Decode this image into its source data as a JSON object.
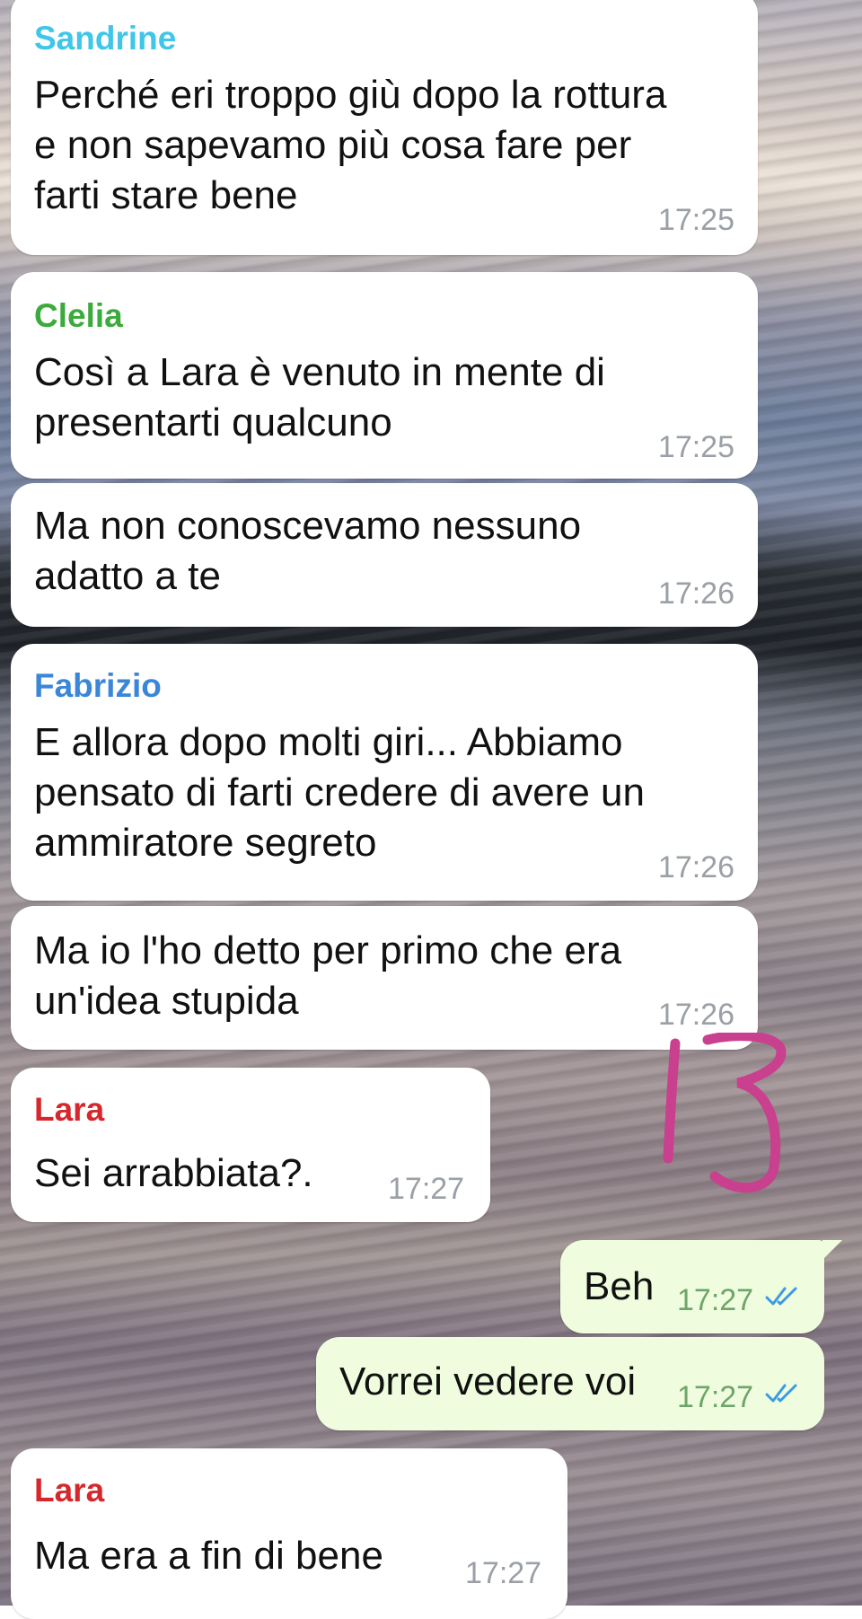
{
  "messages": [
    {
      "sender": "Sandrine",
      "text": "Perché eri troppo giù dopo la rottura\ne non sapevamo più cosa fare per\nfarti stare bene",
      "time": "17:25"
    },
    {
      "sender": "Clelia",
      "text": "Così a Lara è venuto in mente di\npresentarti qualcuno",
      "time": "17:25"
    },
    {
      "sender": "",
      "text": "Ma non conoscevamo nessuno\nadatto a te",
      "time": "17:26"
    },
    {
      "sender": "Fabrizio",
      "text": "E allora dopo molti giri... Abbiamo\npensato di farti credere di avere un\nammiratore segreto",
      "time": "17:26"
    },
    {
      "sender": "",
      "text": "Ma io l'ho detto per primo che era\nun'idea stupida",
      "time": "17:26"
    },
    {
      "sender": "Lara",
      "text": "Sei arrabbiata?.",
      "time": "17:27"
    },
    {
      "sender": "",
      "text": "Beh",
      "time": "17:27",
      "outgoing": true,
      "status": "read"
    },
    {
      "sender": "",
      "text": "Vorrei vedere voi",
      "time": "17:27",
      "outgoing": true,
      "status": "read"
    },
    {
      "sender": "Lara",
      "text": "Ma era a fin di bene",
      "time": "17:27"
    }
  ],
  "colors": {
    "sandrine": "#3fc6e8",
    "clelia": "#3caa3c",
    "fabrizio": "#3a86d8",
    "lara": "#d6282c",
    "read_ticks": "#3a9be6",
    "annotation": "#c8408e"
  },
  "annotation_icon": "handwritten-marker-drawing"
}
